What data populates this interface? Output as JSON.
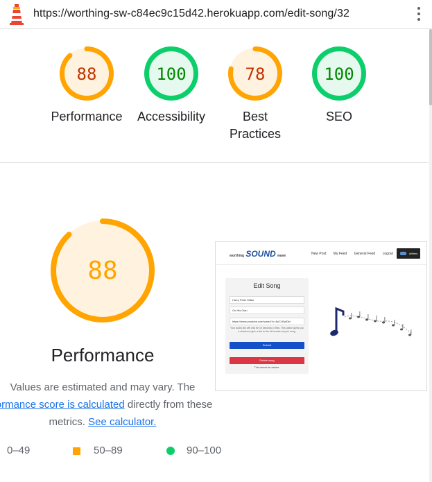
{
  "browser": {
    "url": "https://worthing-sw-c84ec9c15d42.herokuapp.com/edit-song/32"
  },
  "colors": {
    "average": "#ffa400",
    "average_text": "#c33300",
    "average_bg": "#fff3e0",
    "pass": "#0cce6b",
    "pass_text": "#008800",
    "pass_bg": "#e6f9ee",
    "fail": "#ff4e42"
  },
  "summary_gauges": [
    {
      "label": "Performance",
      "score": "88",
      "rating": "average",
      "value": 88
    },
    {
      "label": "Accessibility",
      "score": "100",
      "rating": "pass",
      "value": 100
    },
    {
      "label_line1": "Best",
      "label_line2": "Practices",
      "score": "78",
      "rating": "average",
      "value": 78
    },
    {
      "label": "SEO",
      "score": "100",
      "rating": "pass",
      "value": 100
    }
  ],
  "performance": {
    "score": "88",
    "value": 88,
    "title": "Performance",
    "desc_line1": "Values are estimated and may vary. The",
    "desc_link1": "formance score is calculated",
    "desc_mid": " directly from these",
    "desc_line3_pre": "metrics. ",
    "desc_link2": "See calculator."
  },
  "legend": [
    {
      "range": "0–49",
      "icon": "triangle-icon"
    },
    {
      "range": "50–89",
      "icon": "square-icon"
    },
    {
      "range": "90–100",
      "icon": "circle-icon"
    }
  ],
  "thumbnail": {
    "logo_left": "worthing",
    "logo_mid": "SOUND",
    "logo_right": "wave",
    "nav": [
      "New Post",
      "My Feed",
      "General Feed",
      "Logout"
    ],
    "avatar_label": "drifters",
    "card_title": "Edit Song",
    "fields": [
      "Harry Peter Millar",
      "On His Own",
      "https://www.youtube.com/watch?v=8oCLBwDbI"
    ],
    "help_text": "Your audio clip will only be 15 seconds or less. This option gives you a chance to give a link to the full version of your song.",
    "submit_label": "Submit",
    "delete_label": "Delete song",
    "warning": "This cannot be undone."
  }
}
